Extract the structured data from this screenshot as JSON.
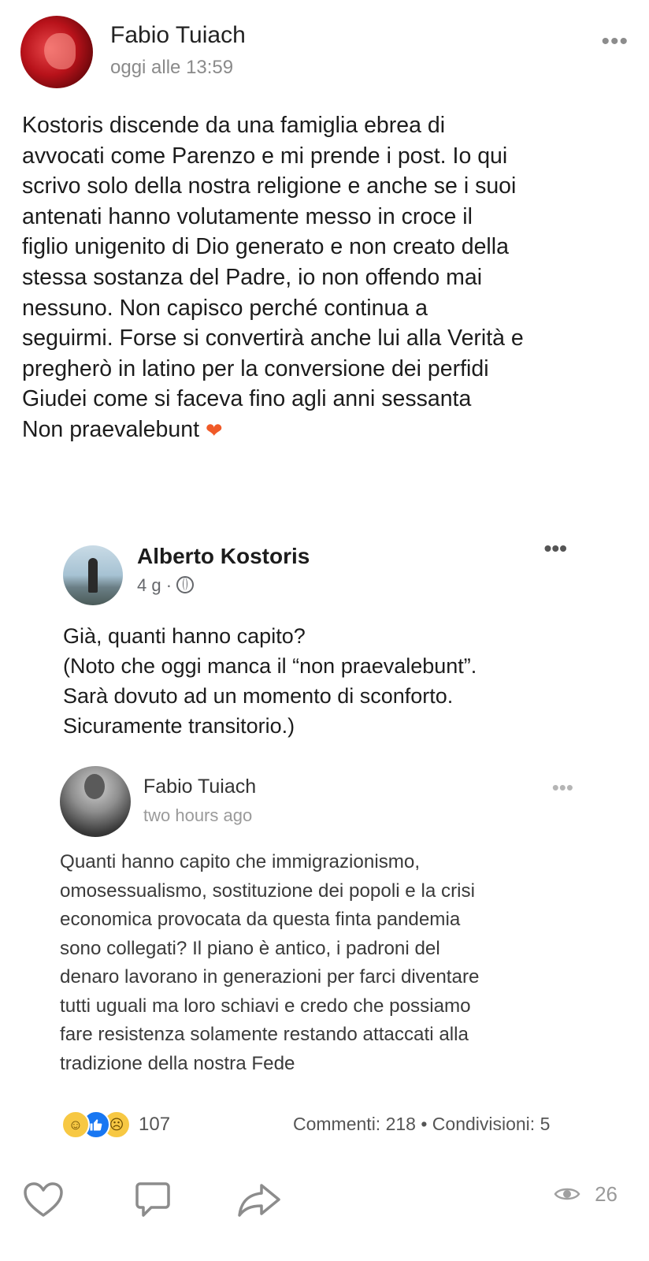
{
  "post": {
    "author": "Fabio Tuiach",
    "timestamp": "oggi alle 13:59",
    "more_label": "•••",
    "text_lines": [
      "Kostoris discende da una famiglia ebrea di",
      "avvocati come Parenzo e mi prende i post. Io qui",
      "scrivo solo della nostra religione e anche se i suoi",
      "antenati hanno volutamente messo in croce il",
      "figlio unigenito di Dio generato e non creato della",
      "stessa sostanza del Padre, io non offendo mai",
      "nessuno. Non capisco perché continua a",
      "seguirmi. Forse si convertirà anche lui alla Verità e",
      "pregherò in latino per la conversione dei perfidi",
      "Giudei come si faceva fino agli anni sessanta",
      "Non praevalebunt"
    ],
    "emoji": "❤"
  },
  "shared": {
    "author": "Alberto Kostoris",
    "age": "4 g",
    "separator": "·",
    "more_label": "•••",
    "text_lines": [
      "Già, quanti hanno capito?",
      "(Noto che oggi manca il “non praevalebunt”.",
      "Sarà dovuto ad un momento di sconforto.",
      "Sicuramente transitorio.)"
    ]
  },
  "inner": {
    "author": "Fabio Tuiach",
    "timestamp": "two hours ago",
    "more_label": "•••",
    "text_lines": [
      "Quanti hanno capito che immigrazionismo,",
      "omosessualismo, sostituzione dei popoli e la crisi",
      "economica provocata da questa finta pandemia",
      "sono collegati? Il piano è antico, i padroni del",
      "denaro lavorano in generazioni per farci diventare",
      "tutti uguali ma loro schiavi e credo che possiamo",
      "fare resistenza solamente restando attaccati alla",
      "tradizione della nostra Fede"
    ]
  },
  "stats": {
    "reaction_icons": [
      "haha-icon",
      "like-icon",
      "sad-icon"
    ],
    "reaction_count": "107",
    "comments_shares": "Commenti: 218 • Condivisioni: 5"
  },
  "actions": {
    "icons": [
      "heart-icon",
      "comment-icon",
      "share-icon"
    ],
    "views": "26"
  },
  "colors": {
    "like_blue": "#1877f2",
    "emoji_yellow": "#f7c843",
    "heart_orange": "#f05a28",
    "muted_text": "#8a8a8a"
  }
}
